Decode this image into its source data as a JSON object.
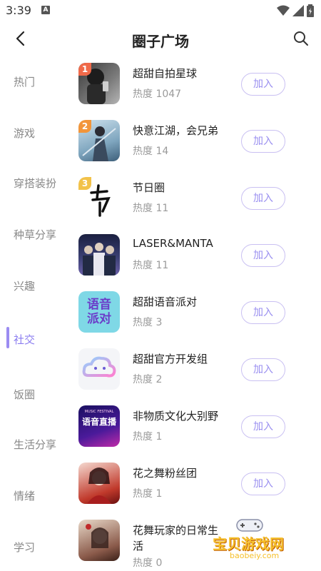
{
  "status": {
    "time": "3:39",
    "app_icon": "A"
  },
  "header": {
    "title": "圈子广场"
  },
  "sidebar": {
    "items": [
      {
        "label": "热门"
      },
      {
        "label": "游戏"
      },
      {
        "label": "穿搭装扮"
      },
      {
        "label": "种草分享"
      },
      {
        "label": "兴趣"
      },
      {
        "label": "社交"
      },
      {
        "label": "饭圈"
      },
      {
        "label": "生活分享"
      },
      {
        "label": "情绪"
      },
      {
        "label": "学习"
      }
    ],
    "active_index": 5
  },
  "circles": [
    {
      "rank": "1",
      "name": "超甜自拍星球",
      "heat": "热度 1047",
      "join": "加入"
    },
    {
      "rank": "2",
      "name": "快意江湖，会兄弟",
      "heat": "热度 14",
      "join": "加入"
    },
    {
      "rank": "3",
      "name": "节日圈",
      "heat": "热度 11",
      "join": "加入"
    },
    {
      "rank": "",
      "name": "LASER&MANTA",
      "heat": "热度 11",
      "join": "加入"
    },
    {
      "rank": "",
      "name": "超甜语音派对",
      "heat": "热度 3",
      "join": "加入",
      "avatar_text": "语音派对"
    },
    {
      "rank": "",
      "name": "超甜官方开发组",
      "heat": "热度 2",
      "join": "加入"
    },
    {
      "rank": "",
      "name": "非物质文化大别野",
      "heat": "热度 1",
      "join": "加入",
      "avatar_text": "语音直播",
      "avatar_sub": "MUSIC FESTIVAL"
    },
    {
      "rank": "",
      "name": "花之舞粉丝团",
      "heat": "热度 1",
      "join": "加入"
    },
    {
      "rank": "",
      "name": "花舞玩家的日常生活",
      "heat": "热度 0",
      "join": ""
    }
  ],
  "rank_colors": [
    "#f06a4a",
    "#f2953a",
    "#f2c24a"
  ],
  "accent": "#8a7cf0",
  "watermark": {
    "text": "宝贝游戏网",
    "url": "baobeiy.com"
  }
}
